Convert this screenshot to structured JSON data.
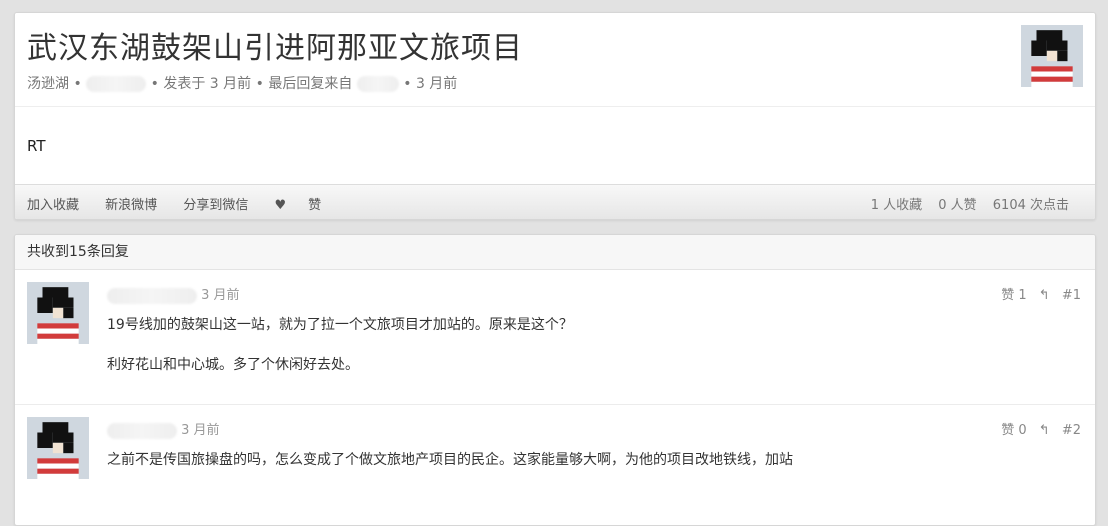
{
  "topic": {
    "title": "武汉东湖鼓架山引进阿那亚文旅项目",
    "node": "汤逊湖",
    "posted": "发表于 3 月前",
    "last_reply_label": "最后回复来自",
    "last_reply_time": "3 月前",
    "content": "RT",
    "actions": [
      "加入收藏",
      "新浪微博",
      "分享到微信",
      "赞"
    ],
    "stats": [
      "1 人收藏",
      "0 人赞",
      "6104 次点击"
    ]
  },
  "replies_header": "共收到15条回复",
  "replies": [
    {
      "time": "3 月前",
      "likes": "赞 1",
      "floor": "#1",
      "lines": [
        "19号线加的鼓架山这一站，就为了拉一个文旅项目才加站的。原来是这个？",
        "利好花山和中心城。多了个休闲好去处。"
      ]
    },
    {
      "time": "3 月前",
      "likes": "赞 0",
      "floor": "#2",
      "lines": [
        "之前不是传国旅操盘的吗，怎么变成了个做文旅地产项目的民企。这家能量够大啊，为他的项目改地铁线，加站"
      ]
    }
  ],
  "colors": {
    "avatar_bg": "#2f5f8a",
    "stripe_red": "#d23b3b",
    "stripe_white": "#ffffff"
  },
  "icons": {
    "heart": "heart-icon",
    "reply": "reply-icon"
  }
}
